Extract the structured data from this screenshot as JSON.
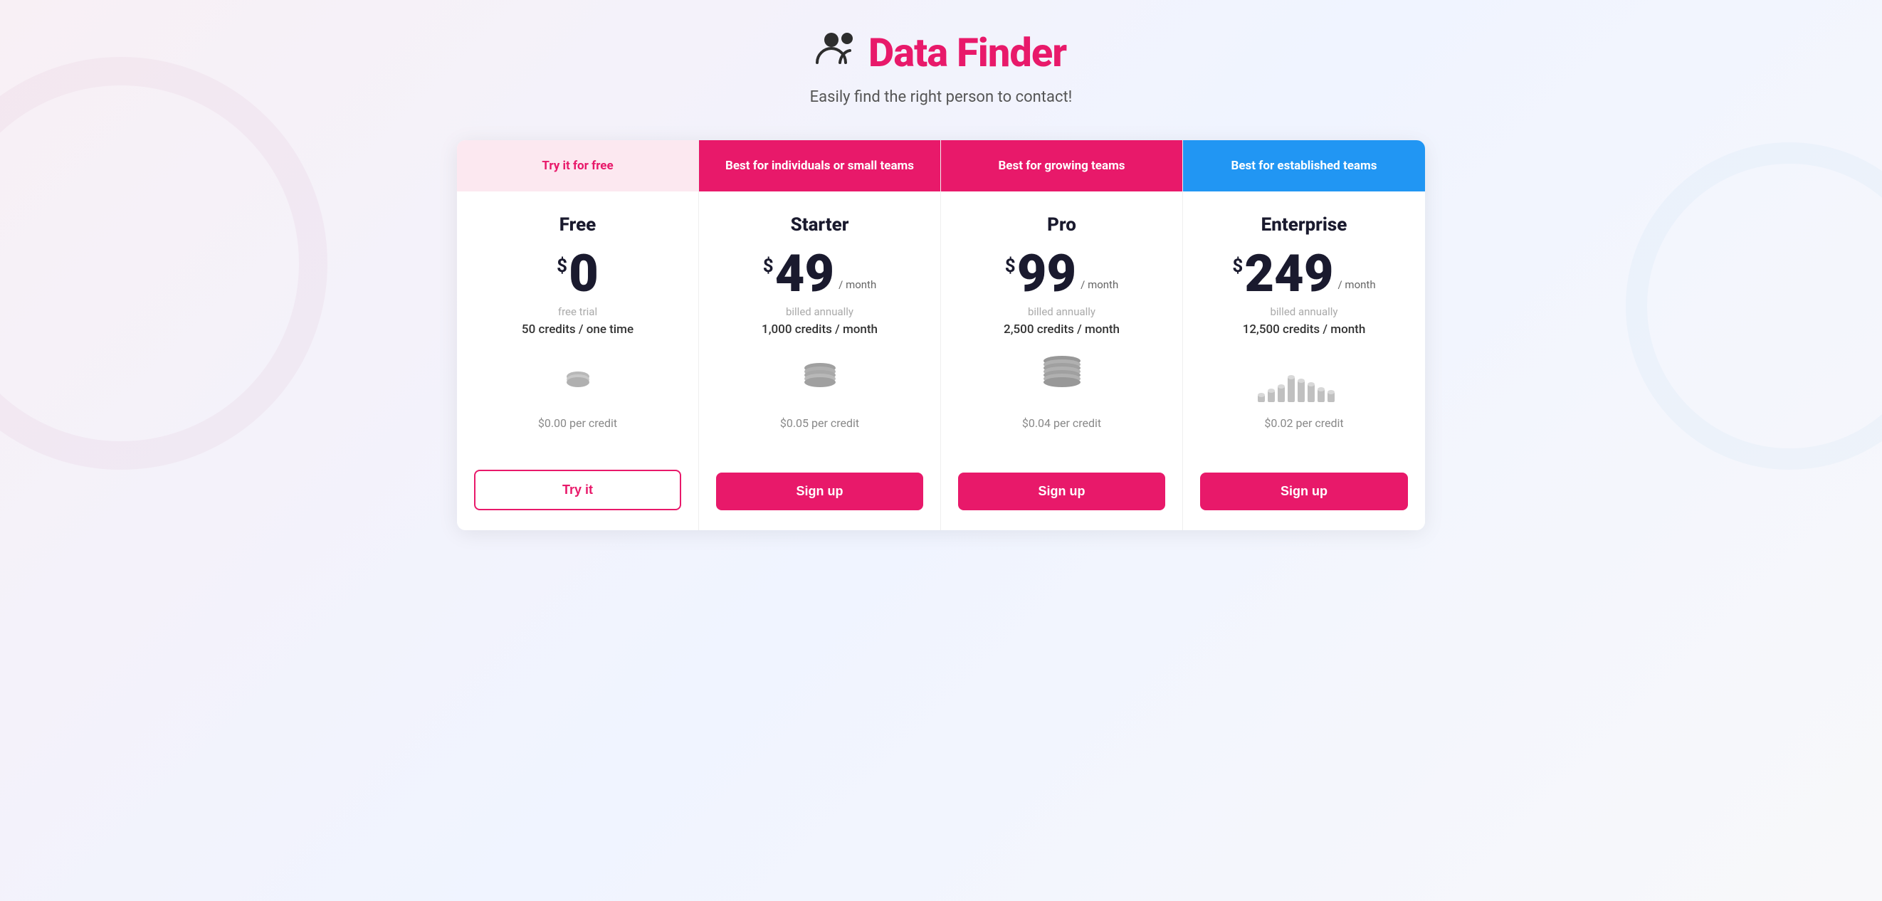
{
  "header": {
    "logo_icon": "👥",
    "logo_text": "Data Finder",
    "subtitle": "Easily find the right person to contact!"
  },
  "plans": [
    {
      "id": "free",
      "header_label": "Try it for free",
      "header_type": "free-header",
      "name": "Free",
      "price": "0",
      "price_period": "",
      "billing_note": "free trial",
      "credits_note": "50 credits / one time",
      "coin_type": "single",
      "per_credit": "$0.00 per credit",
      "button_label": "Try it",
      "button_type": "btn-outline"
    },
    {
      "id": "starter",
      "header_label": "Best for individuals or small teams",
      "header_type": "starter-header",
      "name": "Starter",
      "price": "49",
      "price_period": "/ month",
      "billing_note": "billed annually",
      "credits_note": "1,000 credits / month",
      "coin_type": "small",
      "per_credit": "$0.05 per credit",
      "button_label": "Sign up",
      "button_type": "btn-pink"
    },
    {
      "id": "pro",
      "header_label": "Best for growing teams",
      "header_type": "pro-header",
      "name": "Pro",
      "price": "99",
      "price_period": "/ month",
      "billing_note": "billed annually",
      "credits_note": "2,500 credits / month",
      "coin_type": "medium",
      "per_credit": "$0.04 per credit",
      "button_label": "Sign up",
      "button_type": "btn-pink"
    },
    {
      "id": "enterprise",
      "header_label": "Best for established teams",
      "header_type": "enterprise-header",
      "name": "Enterprise",
      "price": "249",
      "price_period": "/ month",
      "billing_note": "billed annually",
      "credits_note": "12,500 credits / month",
      "coin_type": "large",
      "per_credit": "$0.02 per credit",
      "button_label": "Sign up",
      "button_type": "btn-blue"
    }
  ]
}
